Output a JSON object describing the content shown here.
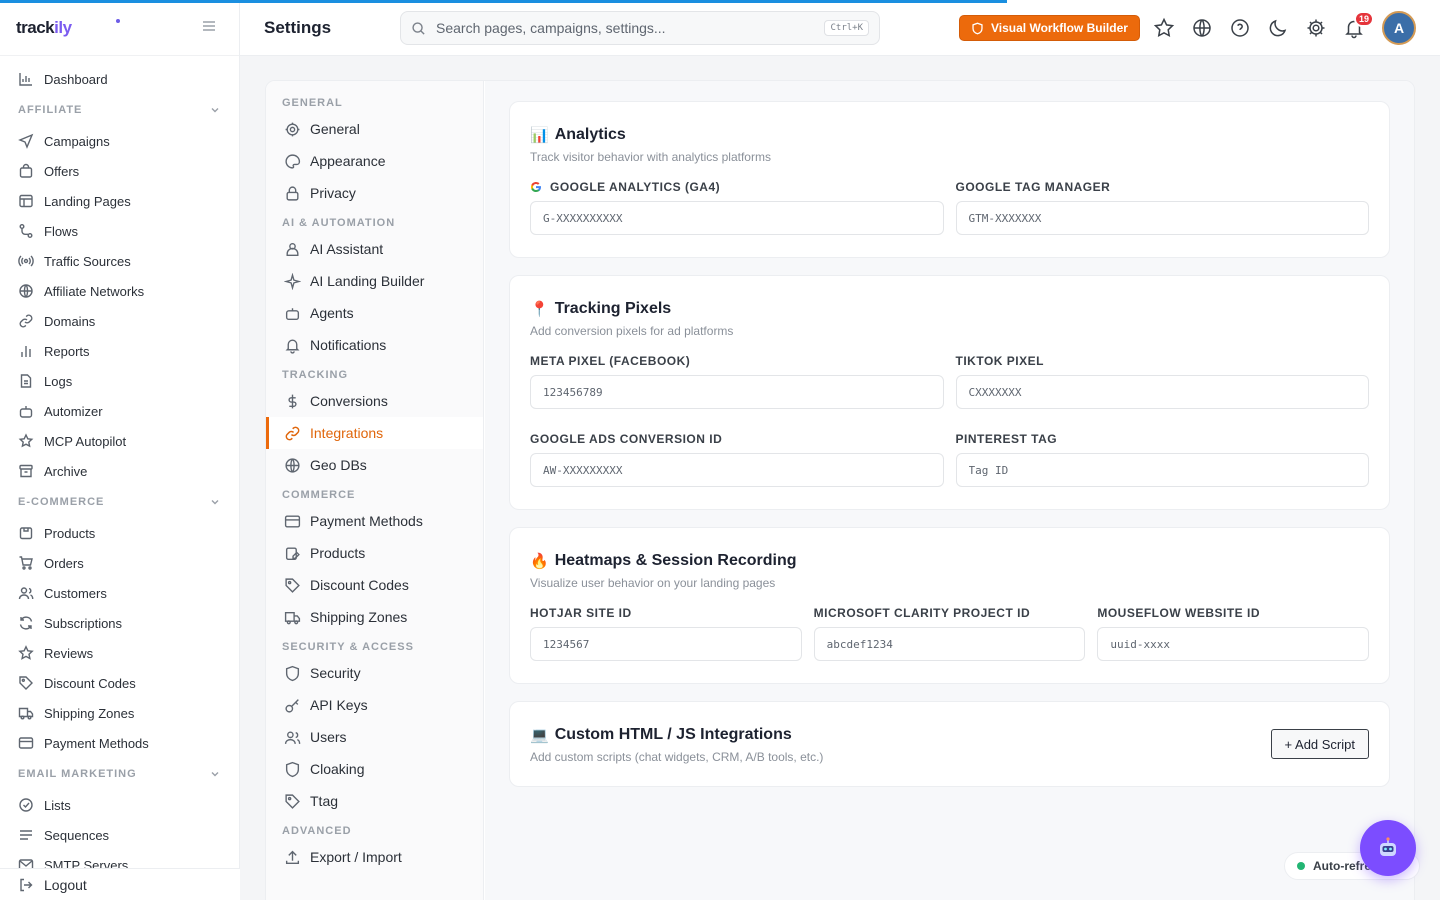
{
  "app": {
    "logo_text": "track",
    "logo_accent": "ily",
    "page_title": "Settings",
    "accent_color": "#ec6a0c",
    "brand_color": "#7b5cf0"
  },
  "search": {
    "placeholder": "Search pages, campaigns, settings...",
    "shortcut": "Ctrl+K"
  },
  "topbar": {
    "workflow_button": "Visual Workflow Builder",
    "notifications_count": "19",
    "avatar_initial": "A"
  },
  "sidebar": {
    "dashboard": "Dashboard",
    "sections": [
      {
        "title": "AFFILIATE",
        "items": [
          "Campaigns",
          "Offers",
          "Landing Pages",
          "Flows",
          "Traffic Sources",
          "Affiliate Networks",
          "Domains",
          "Reports",
          "Logs",
          "Automizer",
          "MCP Autopilot",
          "Archive"
        ]
      },
      {
        "title": "E-COMMERCE",
        "items": [
          "Products",
          "Orders",
          "Customers",
          "Subscriptions",
          "Reviews",
          "Discount Codes",
          "Shipping Zones",
          "Payment Methods"
        ]
      },
      {
        "title": "EMAIL MARKETING",
        "items": [
          "Lists",
          "Sequences",
          "SMTP Servers"
        ]
      }
    ],
    "logout": "Logout"
  },
  "settings_nav": {
    "sections": [
      {
        "title": "GENERAL",
        "items": [
          "General",
          "Appearance",
          "Privacy"
        ]
      },
      {
        "title": "AI & AUTOMATION",
        "items": [
          "AI Assistant",
          "AI Landing Builder",
          "Agents",
          "Notifications"
        ]
      },
      {
        "title": "TRACKING",
        "items": [
          "Conversions",
          "Integrations",
          "Geo DBs"
        ]
      },
      {
        "title": "COMMERCE",
        "items": [
          "Payment Methods",
          "Products",
          "Discount Codes",
          "Shipping Zones"
        ]
      },
      {
        "title": "SECURITY & ACCESS",
        "items": [
          "Security",
          "API Keys",
          "Users",
          "Cloaking",
          "Ttag"
        ]
      },
      {
        "title": "ADVANCED",
        "items": [
          "Export / Import"
        ]
      }
    ],
    "active": "Integrations"
  },
  "analytics": {
    "title": "Analytics",
    "description": "Track visitor behavior with analytics platforms",
    "ga4_label": "GOOGLE ANALYTICS (GA4)",
    "ga4_placeholder": "G-XXXXXXXXXX",
    "gtm_label": "GOOGLE TAG MANAGER",
    "gtm_placeholder": "GTM-XXXXXXX"
  },
  "pixels": {
    "title": "Tracking Pixels",
    "description": "Add conversion pixels for ad platforms",
    "meta_label": "META PIXEL (FACEBOOK)",
    "meta_placeholder": "123456789",
    "tiktok_label": "TIKTOK PIXEL",
    "tiktok_placeholder": "CXXXXXXX",
    "gads_label": "GOOGLE ADS CONVERSION ID",
    "gads_placeholder": "AW-XXXXXXXXX",
    "pinterest_label": "PINTEREST TAG",
    "pinterest_placeholder": "Tag ID"
  },
  "heatmaps": {
    "title": "Heatmaps & Session Recording",
    "description": "Visualize user behavior on your landing pages",
    "hotjar_label": "HOTJAR SITE ID",
    "hotjar_placeholder": "1234567",
    "clarity_label": "MICROSOFT CLARITY PROJECT ID",
    "clarity_placeholder": "abcdef1234",
    "mouseflow_label": "MOUSEFLOW WEBSITE ID",
    "mouseflow_placeholder": "uuid-xxxx"
  },
  "custom": {
    "title": "Custom HTML / JS Integrations",
    "description": "Add custom scripts (chat widgets, CRM, A/B tools, etc.)",
    "add_button": "+ Add Script"
  },
  "status": {
    "auto_refresh": "Auto-refresh"
  }
}
